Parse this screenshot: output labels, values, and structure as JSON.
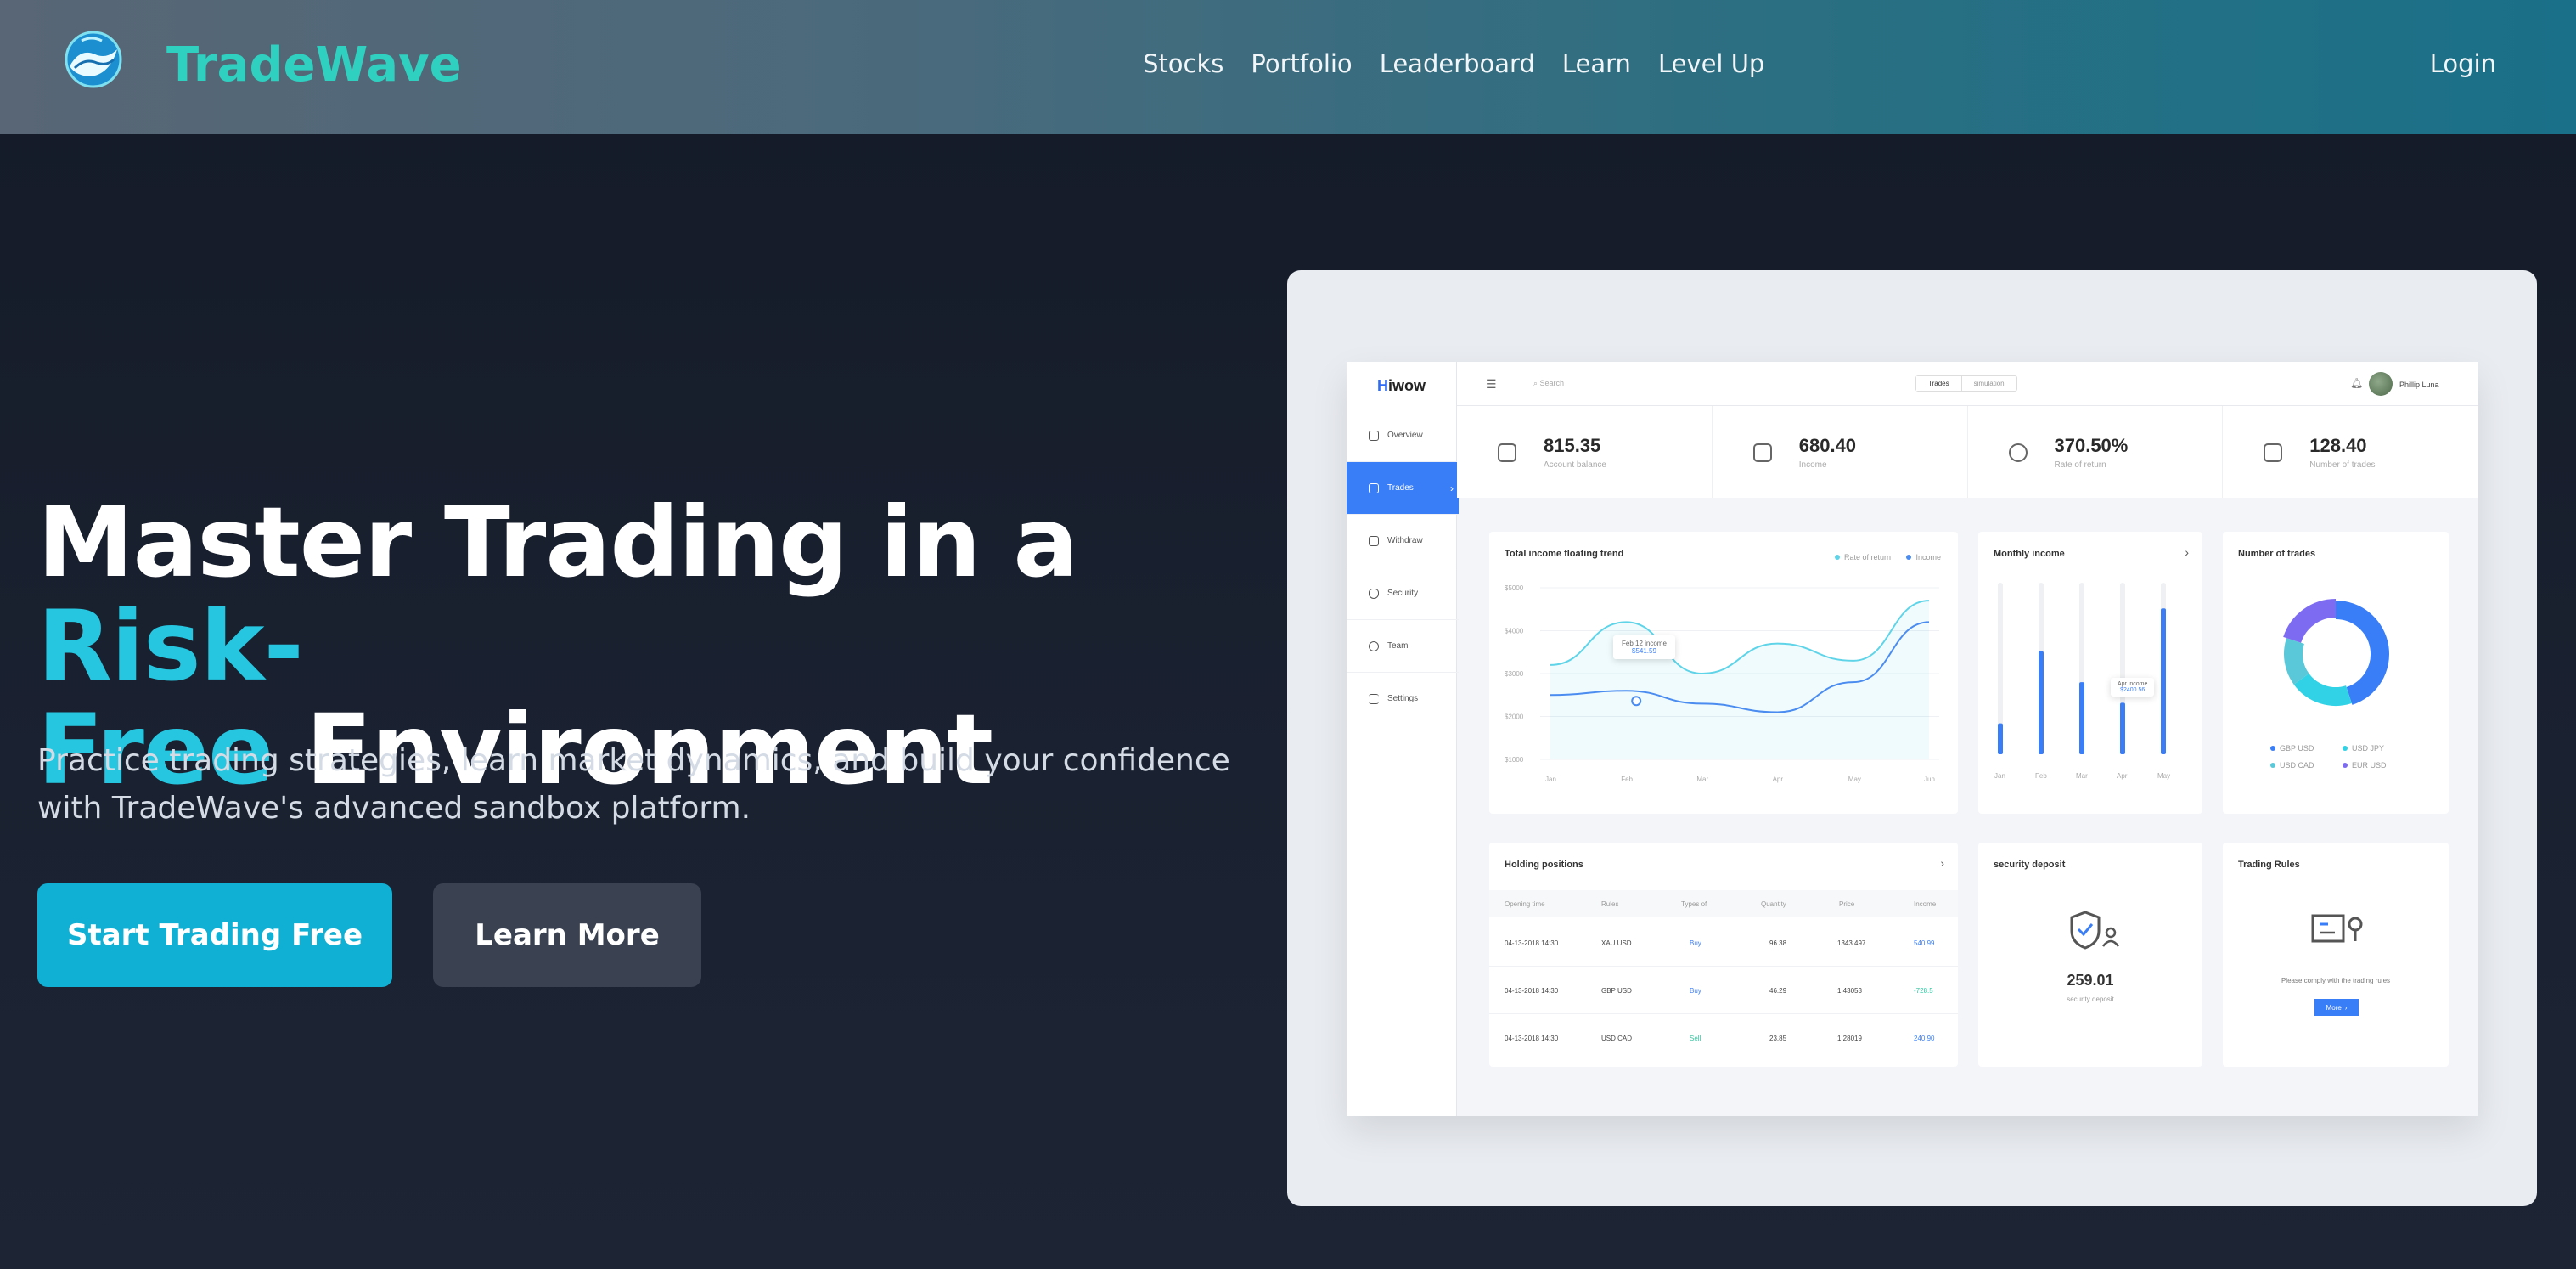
{
  "brand": {
    "name": "TradeWave",
    "color": "#2fd0c0",
    "logo_icon": "wave-globe-icon"
  },
  "nav": {
    "links": [
      {
        "label": "Stocks"
      },
      {
        "label": "Portfolio"
      },
      {
        "label": "Leaderboard"
      },
      {
        "label": "Learn"
      },
      {
        "label": "Level Up"
      }
    ],
    "login": "Login"
  },
  "hero": {
    "title_part1": "Master Trading in a ",
    "title_accent1": "Risk-",
    "title_accent2": "Free",
    "title_part2": " Environment",
    "subtitle": "Practice trading strategies, learn market dynamics, and build your confidence with TradeWave's advanced sandbox platform.",
    "primary_cta": "Start Trading Free",
    "secondary_cta": "Learn More",
    "accent_color": "#26c6e0"
  },
  "preview": {
    "logo_h": "H",
    "logo_rest": "iwow",
    "sidebar": [
      {
        "label": "Overview"
      },
      {
        "label": "Trades"
      },
      {
        "label": "Withdraw"
      },
      {
        "label": "Security"
      },
      {
        "label": "Team"
      },
      {
        "label": "Settings"
      }
    ],
    "search_placeholder": "Search",
    "segments": [
      "Trades",
      "simulation"
    ],
    "user_name": "Phillip Luna",
    "stats": [
      {
        "value": "815.35",
        "label": "Account balance"
      },
      {
        "value": "680.40",
        "label": "Income"
      },
      {
        "value": "370.50%",
        "label": "Rate of return"
      },
      {
        "value": "128.40",
        "label": "Number of trades"
      }
    ],
    "trend": {
      "title": "Total income floating trend",
      "legend": [
        "Rate of return",
        "Income"
      ],
      "tooltip_label": "Feb 12 income",
      "tooltip_value": "$541.59"
    },
    "monthly": {
      "title": "Monthly income",
      "tooltip_label": "Apr income",
      "tooltip_value": "$2400.56"
    },
    "trades": {
      "title": "Number of trades",
      "legend": [
        "GBP USD",
        "USD JPY",
        "USD CAD",
        "EUR USD"
      ]
    },
    "holdings": {
      "title": "Holding positions",
      "columns": [
        "Opening time",
        "Rules",
        "Types of",
        "Quantity",
        "Price",
        "Income"
      ],
      "rows": [
        [
          "04-13-2018 14:30",
          "XAU USD",
          "Buy",
          "96.38",
          "1343.497",
          "540.99"
        ],
        [
          "04-13-2018 14:30",
          "GBP USD",
          "Buy",
          "46.29",
          "1.43053",
          "-728.5"
        ],
        [
          "04-13-2018 14:30",
          "USD CAD",
          "Sell",
          "23.85",
          "1.28019",
          "240.90"
        ]
      ]
    },
    "deposit": {
      "title": "security deposit",
      "value": "259.01",
      "label": "security deposit"
    },
    "rules": {
      "title": "Trading Rules",
      "text": "Please comply with the trading rules",
      "button": "More"
    }
  },
  "chart_data": [
    {
      "type": "line",
      "title": "Total income floating trend",
      "x": [
        "Jan",
        "Feb",
        "Mar",
        "Apr",
        "May",
        "Jun"
      ],
      "ylabel": "",
      "yticks": [
        "$5000",
        "$4000",
        "$3000",
        "$2000",
        "$1000"
      ],
      "ylim": [
        1000,
        5000
      ],
      "series": [
        {
          "name": "Rate of return",
          "color": "#5fd4e8",
          "values": [
            3200,
            4200,
            3000,
            3700,
            3300,
            4700
          ]
        },
        {
          "name": "Income",
          "color": "#4b8cf0",
          "values": [
            2500,
            2600,
            2300,
            2100,
            2800,
            4200
          ]
        }
      ]
    },
    {
      "type": "bar",
      "title": "Monthly income",
      "categories": [
        "Jan",
        "Feb",
        "Mar",
        "Apr",
        "May"
      ],
      "values": [
        18,
        60,
        42,
        30,
        85
      ],
      "ylim": [
        0,
        100
      ],
      "color": "#3a7ef7"
    },
    {
      "type": "pie",
      "title": "Number of trades",
      "categories": [
        "GBP USD",
        "USD JPY",
        "USD CAD",
        "EUR USD"
      ],
      "values": [
        45,
        20,
        15,
        20
      ],
      "colors": [
        "#3a7ef7",
        "#32d2e6",
        "#5ac8d8",
        "#7d6cf2"
      ]
    }
  ]
}
